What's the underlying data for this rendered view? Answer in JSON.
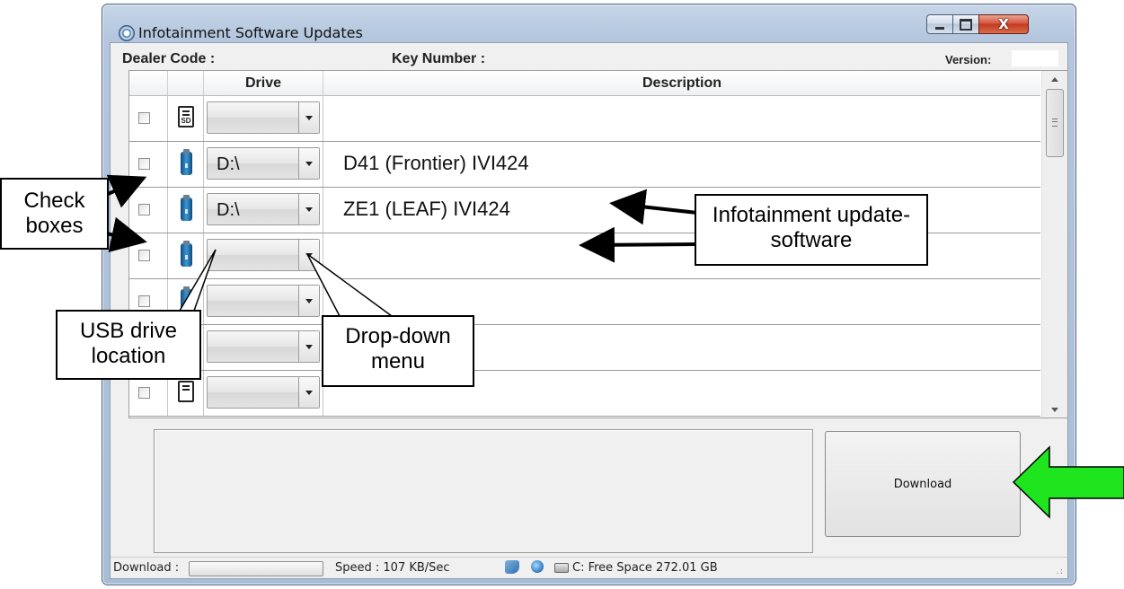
{
  "window": {
    "title": "Infotainment Software Updates",
    "controls": {
      "minimize_glyph": "",
      "maximize_glyph": "",
      "close_glyph": "X"
    }
  },
  "header": {
    "dealer_code_label": "Dealer Code :",
    "key_number_label": "Key Number :",
    "version_label": "Version:",
    "version_value": ""
  },
  "grid": {
    "columns": {
      "checkbox": "",
      "icon": "",
      "drive": "Drive",
      "description": "Description"
    },
    "rows": [
      {
        "checked": false,
        "media_icon": "sd-card-icon",
        "sd_text": "SD",
        "drive": "",
        "description": ""
      },
      {
        "checked": false,
        "media_icon": "usb-drive-icon",
        "drive": "D:\\",
        "description": "D41 (Frontier) IVI424"
      },
      {
        "checked": false,
        "media_icon": "usb-drive-icon",
        "drive": "D:\\",
        "description": "ZE1 (LEAF) IVI424"
      },
      {
        "checked": false,
        "media_icon": "usb-drive-icon",
        "drive": "",
        "description": ""
      },
      {
        "checked": false,
        "media_icon": "usb-drive-icon",
        "drive": "",
        "description": ""
      },
      {
        "checked": false,
        "media_icon": "usb-drive-icon",
        "drive": "",
        "description": ""
      },
      {
        "checked": false,
        "media_icon": "sd-card-icon",
        "drive": "",
        "description": ""
      }
    ]
  },
  "download_button": {
    "label": "Download"
  },
  "status_bar": {
    "download_label": "Download :",
    "progress": 0,
    "speed": "Speed : 107 KB/Sec",
    "free_space": "C: Free Space 272.01 GB",
    "icons": [
      "network-icon",
      "globe-icon",
      "drive-icon"
    ]
  },
  "annotations": {
    "check_boxes": "Check boxes",
    "infotainment": "Infotainment update-software",
    "usb_location": "USB drive location",
    "drop_down": "Drop-down menu",
    "arrow_color": "#1ee51e",
    "pointer_color": "#000000"
  }
}
